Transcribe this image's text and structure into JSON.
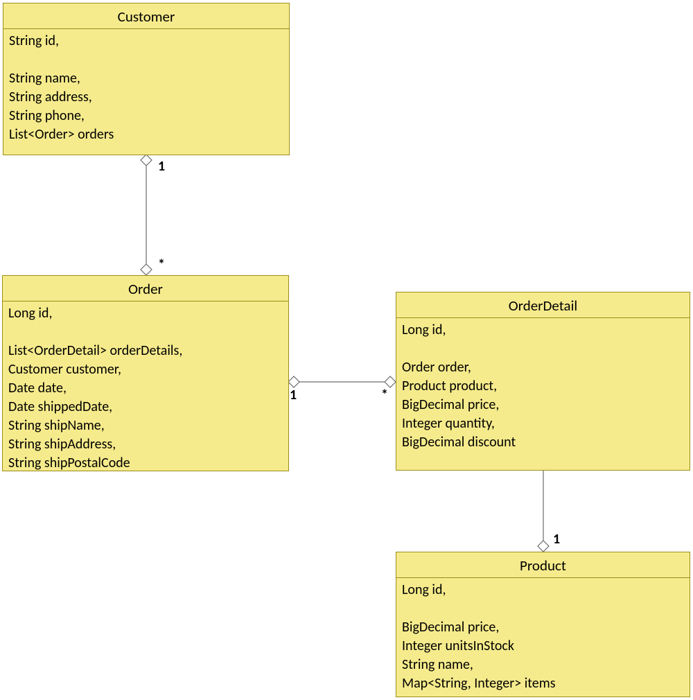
{
  "classes": {
    "customer": {
      "title": "Customer",
      "body": "String id,\n\nString name,\nString address,\nString phone,\nList<Order> orders"
    },
    "order": {
      "title": "Order",
      "body": "Long id,\n\nList<OrderDetail> orderDetails,\nCustomer customer,\nDate date,\nDate shippedDate,\nString shipName,\nString shipAddress,\nString shipPostalCode"
    },
    "orderDetail": {
      "title": "OrderDetail",
      "body": "Long id,\n\nOrder order,\nProduct product,\nBigDecimal price,\nInteger quantity,\nBigDecimal discount"
    },
    "product": {
      "title": "Product",
      "body": "Long id,\n\nBigDecimal price,\nInteger unitsInStock\nString name,\nMap<String, Integer> items"
    }
  },
  "multiplicities": {
    "customerOrder_top": "1",
    "customerOrder_bottom": "*",
    "orderDetail_left": "1",
    "orderDetail_right": "*",
    "orderDetailProduct_bottom": "1"
  }
}
